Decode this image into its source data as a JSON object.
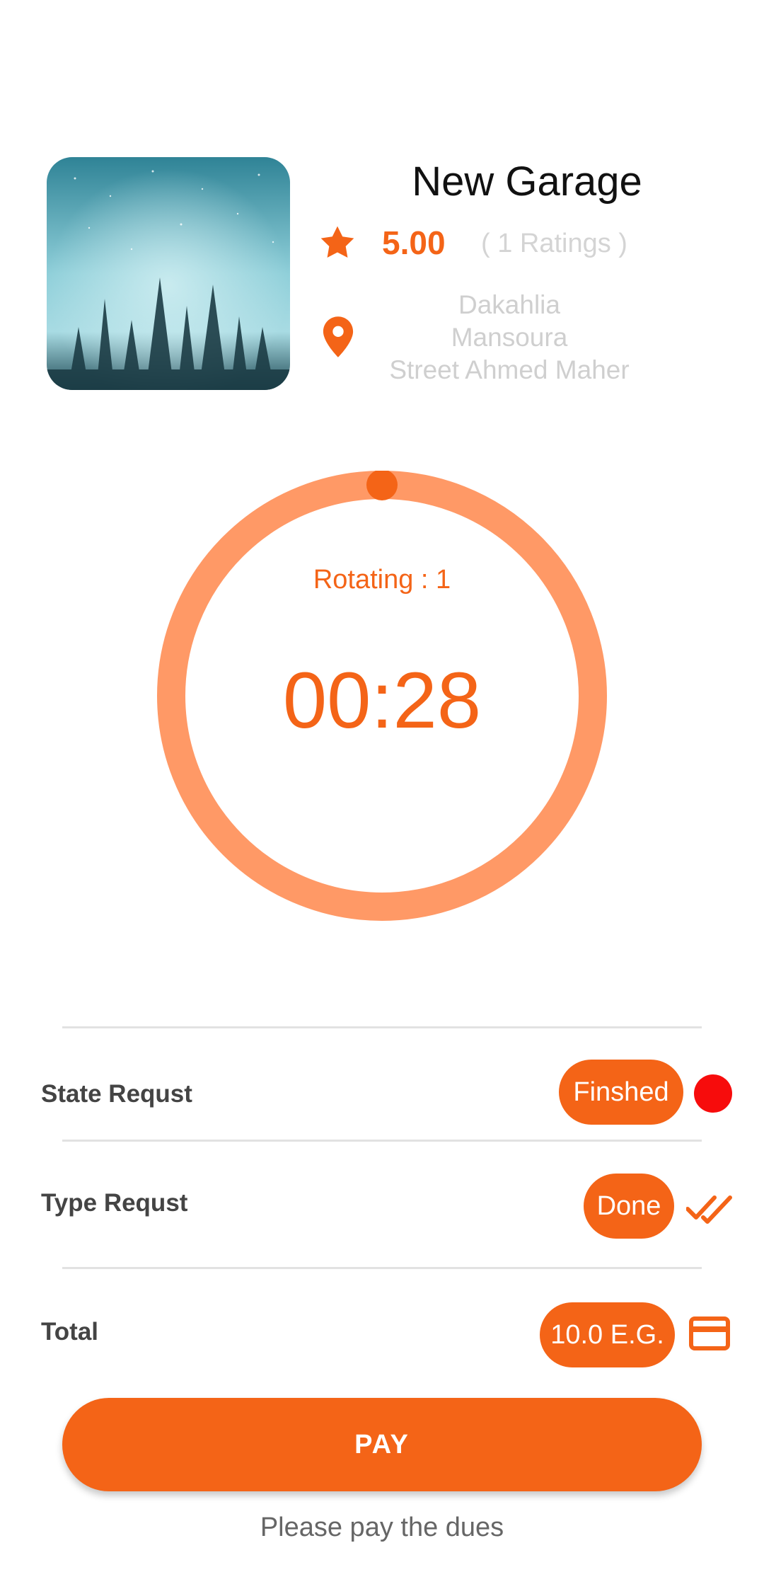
{
  "garage": {
    "name": "New Garage",
    "rating": "5.00",
    "ratings_count": "( 1 Ratings )",
    "address_lines": [
      "Dakahlia",
      "Mansoura",
      "Street Ahmed Maher"
    ]
  },
  "timer": {
    "rotating_label": "Rotating : 1",
    "time": "00:28"
  },
  "details": {
    "state_label": "State Requst",
    "state_value": "Finshed",
    "type_label": "Type Requst",
    "type_value": "Done",
    "total_label": "Total",
    "total_value": "10.0 E.G."
  },
  "actions": {
    "pay_label": "PAY",
    "pay_hint": "Please pay the dues"
  },
  "icons": {
    "rating": "star-icon",
    "location": "location-pin-icon",
    "type_status": "double-check-icon",
    "payment": "credit-card-icon"
  },
  "colors": {
    "accent": "#F46417",
    "ring": "#FF9966",
    "status_dot": "#F70C0C"
  }
}
